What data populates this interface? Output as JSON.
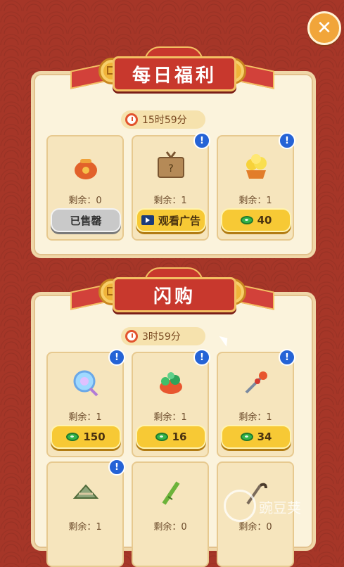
{
  "close_button": {
    "label": "✕"
  },
  "daily": {
    "title": "每日福利",
    "timer": "15时59分",
    "items": [
      {
        "name": "lucky-bag",
        "remain": "剩余：0",
        "button": {
          "type": "sold_out",
          "label": "已售罄"
        },
        "info": false
      },
      {
        "name": "mystery-box",
        "remain": "剩余：1",
        "button": {
          "type": "ad",
          "label": "观看广告"
        },
        "info": true
      },
      {
        "name": "gold-ingots",
        "remain": "剩余：1",
        "button": {
          "type": "price",
          "label": "40"
        },
        "info": true
      }
    ]
  },
  "flash": {
    "title": "闪购",
    "timer": "3时59分",
    "items": [
      {
        "name": "crystal-orb",
        "remain": "剩余：1",
        "button": {
          "type": "price",
          "label": "150"
        },
        "info": true
      },
      {
        "name": "jade-treasure",
        "remain": "剩余：1",
        "button": {
          "type": "price",
          "label": "16"
        },
        "info": true
      },
      {
        "name": "hairpin",
        "remain": "剩余：1",
        "button": {
          "type": "price",
          "label": "34"
        },
        "info": true
      },
      {
        "name": "zongzi",
        "remain": "剩余：1",
        "button": null,
        "info": true
      },
      {
        "name": "bamboo-rod",
        "remain": "剩余：0",
        "button": null,
        "info": false
      },
      {
        "name": "pipe",
        "remain": "剩余：0",
        "button": null,
        "info": false
      }
    ]
  },
  "watermark": {
    "text": "豌豆荚"
  },
  "colors": {
    "background": "#a63628",
    "panel": "#fbf3dc",
    "banner": "#c8382d",
    "button_yellow": "#f7c935",
    "button_gray": "#c9c9c9",
    "info_blue": "#2563d6"
  }
}
